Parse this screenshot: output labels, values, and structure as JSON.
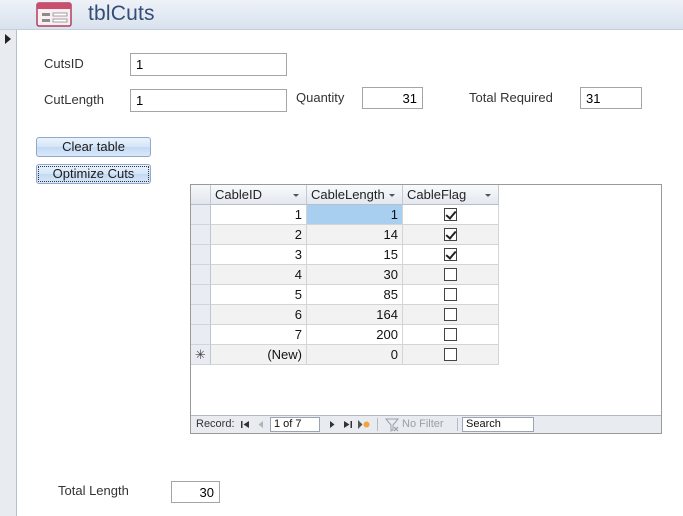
{
  "form": {
    "title": "tblCuts"
  },
  "fields": {
    "cuts_id": {
      "label": "CutsID",
      "value": "1"
    },
    "cut_length": {
      "label": "CutLength",
      "value": "1"
    },
    "quantity": {
      "label": "Quantity",
      "value": "31"
    },
    "total_required": {
      "label": "Total Required",
      "value": "31"
    },
    "total_length": {
      "label": "Total Length",
      "value": "30"
    }
  },
  "buttons": {
    "clear_table": "Clear table",
    "optimize_cuts": "Optimize Cuts"
  },
  "datasheet": {
    "columns": [
      "CableID",
      "CableLength",
      "CableFlag"
    ],
    "rows": [
      {
        "id": "1",
        "length": "1",
        "flag": true
      },
      {
        "id": "2",
        "length": "14",
        "flag": true
      },
      {
        "id": "3",
        "length": "15",
        "flag": true
      },
      {
        "id": "4",
        "length": "30",
        "flag": false
      },
      {
        "id": "5",
        "length": "85",
        "flag": false
      },
      {
        "id": "6",
        "length": "164",
        "flag": false
      },
      {
        "id": "7",
        "length": "200",
        "flag": false
      }
    ],
    "new_row": {
      "id": "(New)",
      "length": "0",
      "flag": false
    },
    "new_row_marker": "✳",
    "selected_row_index": 0
  },
  "navigation": {
    "record_label": "Record:",
    "first_icon": "first-record-icon",
    "prev_icon": "previous-record-icon",
    "position": "1 of 7",
    "next_icon": "next-record-icon",
    "last_icon": "last-record-icon",
    "new_icon": "new-record-icon",
    "filter_label": "No Filter",
    "search_label": "Search"
  },
  "colors": {
    "header_title": "#344d76",
    "selected_cell": "#a8cef0",
    "button_gradient_top": "#eaf3fd"
  }
}
